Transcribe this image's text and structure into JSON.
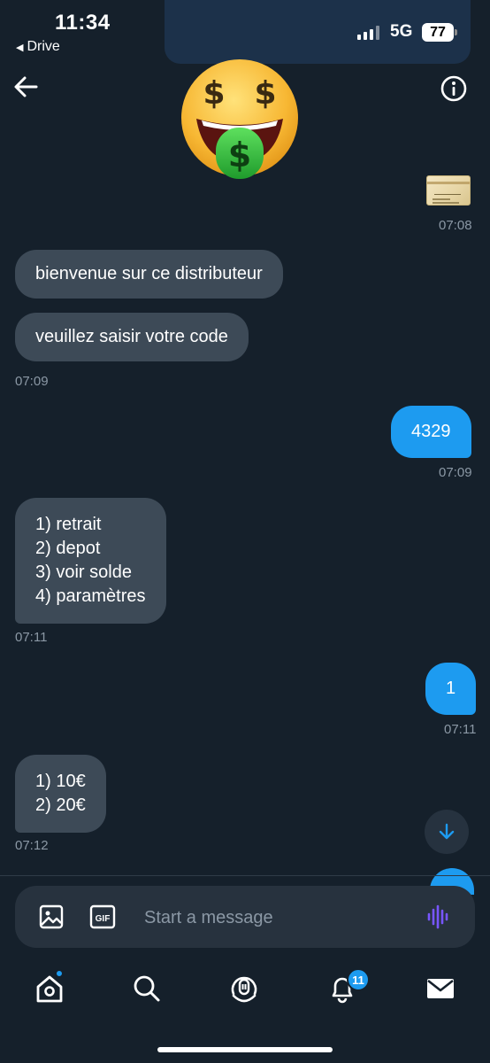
{
  "status_bar": {
    "time": "11:34",
    "back_app": "Drive",
    "network": "5G",
    "battery": "77"
  },
  "header": {
    "back_icon": "arrow-left-icon",
    "info_icon": "info-circle-icon",
    "avatar_icon": "money-mouth-face-emoji"
  },
  "messages": [
    {
      "direction": "out",
      "type": "image",
      "image": "credit-card-image",
      "time": "07:08"
    },
    {
      "direction": "in",
      "text": "bienvenue sur ce distributeur"
    },
    {
      "direction": "in",
      "text": "veuillez saisir votre code",
      "time": "07:09"
    },
    {
      "direction": "out",
      "text": "4329",
      "time": "07:09"
    },
    {
      "direction": "in",
      "text": "1) retrait\n2) depot\n3) voir solde\n4) paramètres",
      "time": "07:11"
    },
    {
      "direction": "out",
      "text": "1",
      "time": "07:11"
    },
    {
      "direction": "in",
      "text": "1) 10€\n2) 20€",
      "time": "07:12"
    }
  ],
  "composer": {
    "placeholder": "Start a message",
    "value": "",
    "image_icon": "image-icon",
    "gif_icon": "gif-icon",
    "gif_label": "GIF",
    "voice_icon": "voice-wave-icon"
  },
  "bottom_nav": {
    "items": [
      "home-icon",
      "search-icon",
      "spaces-icon",
      "notifications-icon",
      "messages-icon"
    ],
    "notifications_count": "11"
  },
  "colors": {
    "background": "#15202b",
    "incoming_bubble": "#3d4a57",
    "outgoing_bubble": "#1d9bf0",
    "timestamp": "#8b98a5",
    "voice_accent": "#7856ff"
  }
}
